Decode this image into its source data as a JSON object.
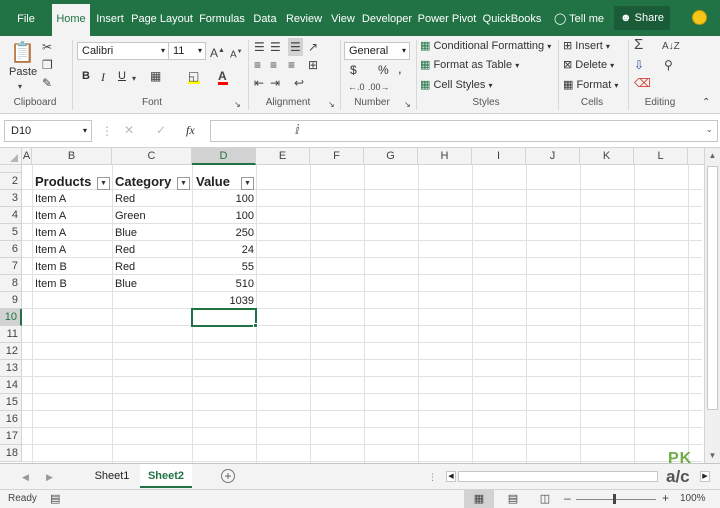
{
  "ribbon_tabs": [
    "File",
    "Home",
    "Insert",
    "Page Layout",
    "Formulas",
    "Data",
    "Review",
    "View",
    "Developer",
    "Power Pivot",
    "QuickBooks",
    "Tell me",
    "Share"
  ],
  "active_tab": "Home",
  "clipboard": {
    "paste_label": "Paste",
    "group_label": "Clipboard"
  },
  "font": {
    "name": "Calibri",
    "size": "11",
    "bold": "B",
    "italic": "I",
    "underline": "U",
    "group_label": "Font"
  },
  "alignment": {
    "group_label": "Alignment"
  },
  "number": {
    "format": "General",
    "currency": "$",
    "percent": "%",
    "comma": ",",
    "group_label": "Number"
  },
  "styles": {
    "conditional": "Conditional Formatting",
    "format_table": "Format as Table",
    "cell_styles": "Cell Styles",
    "group_label": "Styles"
  },
  "cells": {
    "insert": "Insert",
    "delete": "Delete",
    "format": "Format",
    "group_label": "Cells"
  },
  "editing": {
    "group_label": "Editing"
  },
  "formula_bar": {
    "name_box": "D10",
    "fx": "fx",
    "formula": ""
  },
  "columns": [
    "A",
    "B",
    "C",
    "D",
    "E",
    "F",
    "G",
    "H",
    "I",
    "J",
    "K",
    "L"
  ],
  "rows": [
    "2",
    "3",
    "4",
    "5",
    "6",
    "7",
    "8",
    "9",
    "10",
    "11",
    "12",
    "13",
    "14",
    "15",
    "16",
    "17",
    "18"
  ],
  "table": {
    "headers": [
      "Products",
      "Category",
      "Value"
    ],
    "data": [
      [
        "Item A",
        "Red",
        "100"
      ],
      [
        "Item A",
        "Green",
        "100"
      ],
      [
        "Item A",
        "Blue",
        "250"
      ],
      [
        "Item A",
        "Red",
        "24"
      ],
      [
        "Item B",
        "Red",
        "55"
      ],
      [
        "Item B",
        "Blue",
        "510"
      ]
    ],
    "total": "1039"
  },
  "selected_cell": "D10",
  "sheets": [
    "Sheet1",
    "Sheet2"
  ],
  "active_sheet": "Sheet2",
  "status": {
    "ready": "Ready",
    "zoom": "100%"
  },
  "watermark": {
    "top": "PK",
    "bottom": "a/c"
  },
  "colors": {
    "excel_green": "#217346",
    "ribbon_bg": "#f3f3f3"
  }
}
